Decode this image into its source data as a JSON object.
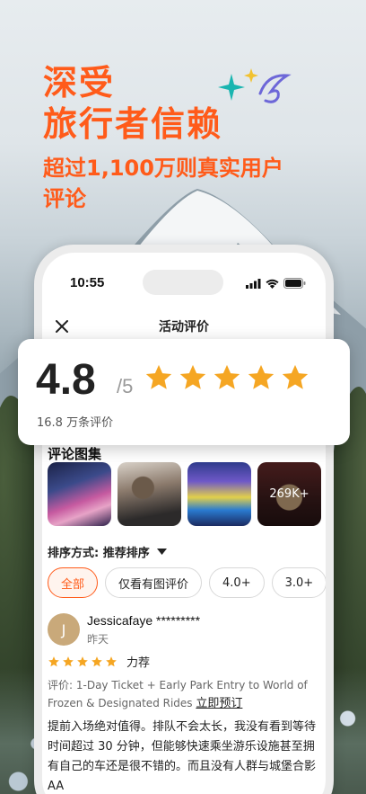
{
  "headline": {
    "line1": "深受",
    "line2": "旅行者信赖",
    "sub": "超过1,100万则真实用户评论"
  },
  "status_bar": {
    "time": "10:55"
  },
  "nav": {
    "title": "活动评价",
    "close_icon": "close-icon"
  },
  "rating": {
    "score": "4.8",
    "max": "/5",
    "stars": 5,
    "count_text": "16.8 万条评价",
    "star_color": "#f5a623"
  },
  "gallery": {
    "title": "评论图集",
    "more_count": "269K+"
  },
  "sort": {
    "label": "排序方式:",
    "value": "推荐排序"
  },
  "filters": [
    "全部",
    "仅看有图评价",
    "4.0+",
    "3.0+"
  ],
  "review": {
    "avatar_letter": "J",
    "name": "Jessicafaye *********",
    "date": "昨天",
    "stars": 5,
    "tag": "力荐",
    "meta_prefix": "评价:",
    "meta_item": "1-Day Ticket + Early Park Entry to World of Frozen & Designated Rides",
    "book_link": "立即预订",
    "text": "提前入场绝对值得。排队不会太长，我没有看到等待时间超过 30 分钟，但能够快速乘坐游乐设施甚至拥有自己的车还是很不错的。而且没有人群与城堡合影 AA"
  },
  "colors": {
    "accent": "#ff5b1a",
    "star": "#f5a623"
  }
}
